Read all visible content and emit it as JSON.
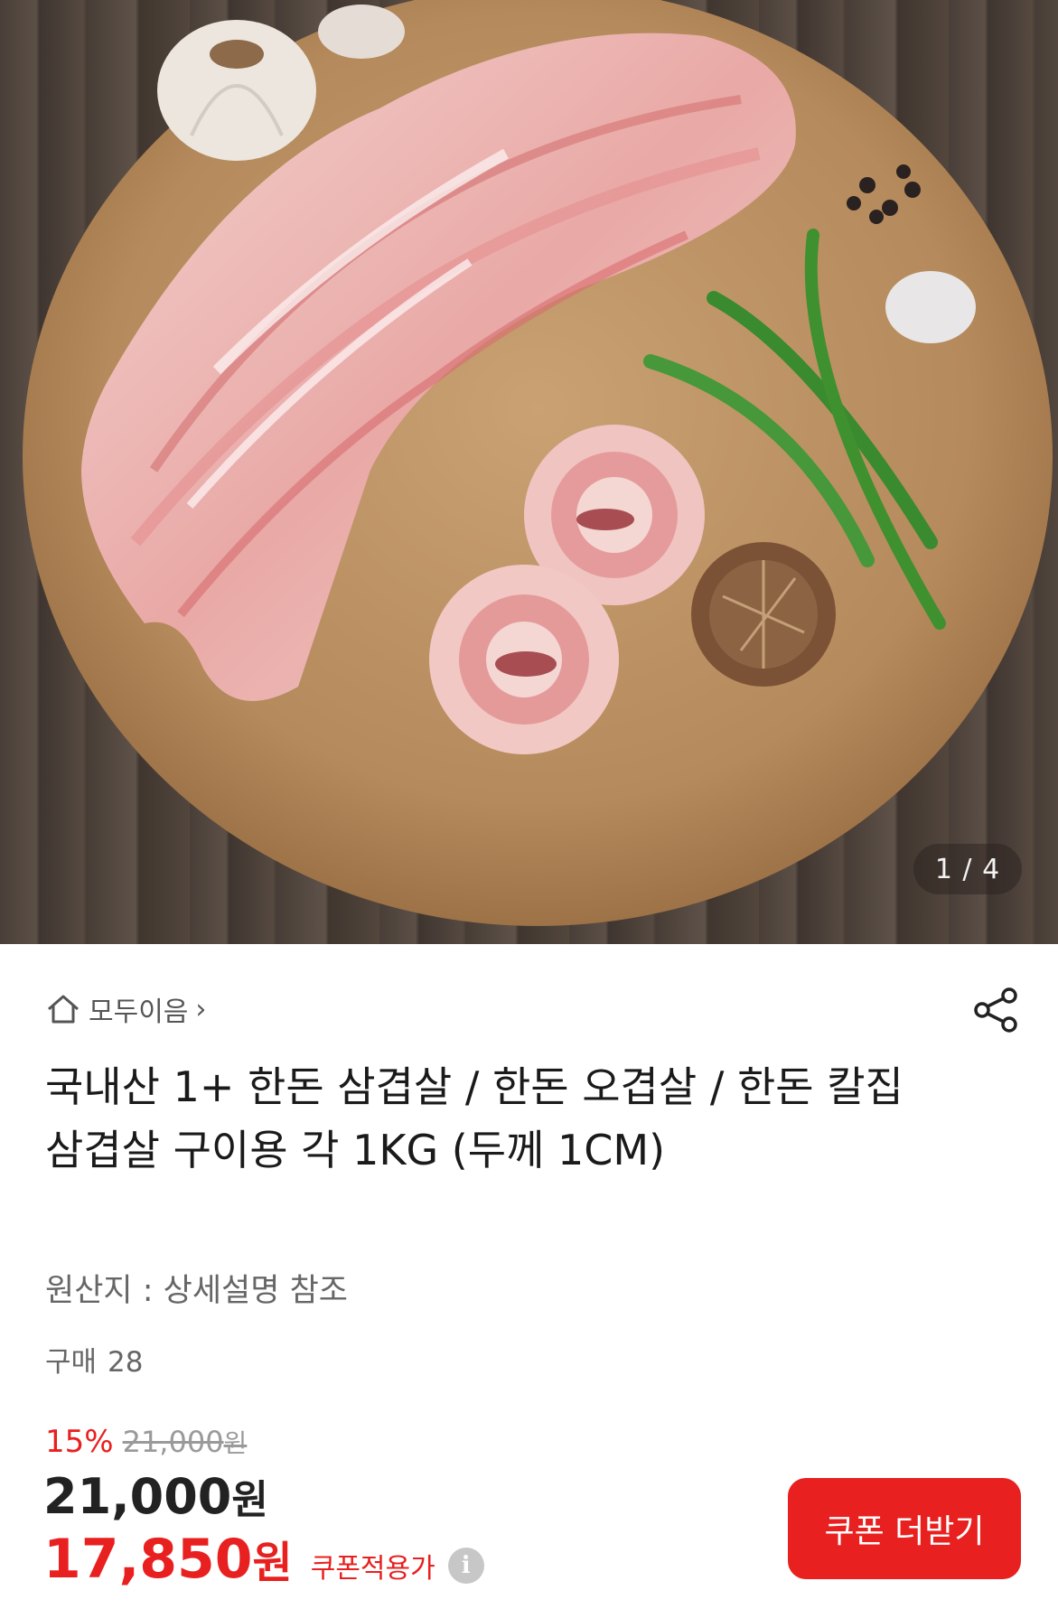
{
  "gallery": {
    "image_alt": "삼겹살 상품 이미지",
    "counter": "1 / 4"
  },
  "store": {
    "name": "모두이음",
    "icon": "home-icon",
    "chevron": "›"
  },
  "share_icon": "share-icon",
  "product": {
    "title": "국내산 1+ 한돈 삼겹살 / 한돈 오겹살 / 한돈 칼집 삼겹살 구이용 각 1KG (두께 1CM)",
    "origin": "원산지 : 상세설명 참조",
    "purchase_label": "구매",
    "purchase_count": "28"
  },
  "price": {
    "discount_rate": "15%",
    "original_price": "21,000",
    "currency": "원",
    "sale_price": "21,000",
    "coupon_price": "17,850",
    "coupon_label": "쿠폰적용가",
    "info_icon": "i",
    "accent_color": "#e8201f"
  },
  "coupon_button": {
    "label": "쿠폰 더받기"
  }
}
